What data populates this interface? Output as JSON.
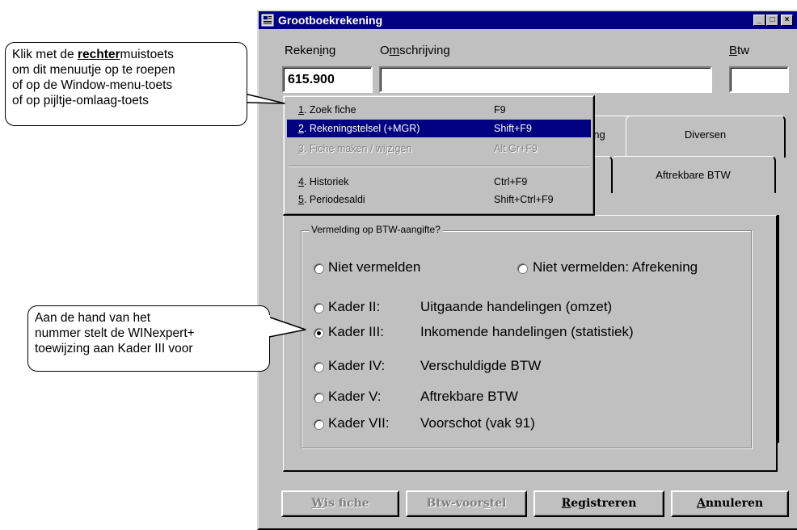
{
  "window": {
    "title": "Grootboekrekening",
    "controls": {
      "minimize": "_",
      "maximize": "□",
      "close": "×"
    }
  },
  "form": {
    "rekening_label_pre": "Reken",
    "rekening_label_key": "i",
    "rekening_label_post": "ng",
    "omschrijving_label_pre": "O",
    "omschrijving_label_key": "m",
    "omschrijving_label_post": "schrijving",
    "btw_label_key": "B",
    "btw_label_post": "tw",
    "rekening_value": "615.900",
    "omschrijving_value": "",
    "btw_value": ""
  },
  "tabs": {
    "row1": [
      "ng",
      "Diversen"
    ],
    "row2": [
      "Aftrekbare BTW"
    ]
  },
  "context_menu": {
    "items": [
      {
        "num": "1",
        "label": ". Zoek fiche",
        "shortcut": "F9",
        "state": "normal"
      },
      {
        "num": "2",
        "label": ". Rekeningstelsel (+MGR)",
        "shortcut": "Shift+F9",
        "state": "selected"
      },
      {
        "num": "3",
        "label": ". Fiche maken / wijzigen",
        "shortcut": "Alt Gr+F9",
        "state": "disabled"
      },
      {
        "num": "4",
        "label": ". Historiek",
        "shortcut": "Ctrl+F9",
        "state": "normal"
      },
      {
        "num": "5",
        "label": ". Periodesaldi",
        "shortcut": "Shift+Ctrl+F9",
        "state": "normal"
      }
    ]
  },
  "btw_group": {
    "title": "Vermelding op BTW-aangifte?",
    "top_options": [
      "Niet vermelden",
      "Niet vermelden: Afrekening"
    ],
    "kader_options": [
      {
        "kader": "Kader II:",
        "desc": "Uitgaande handelingen (omzet)",
        "checked": false
      },
      {
        "kader": "Kader III:",
        "desc": "Inkomende handelingen (statistiek)",
        "checked": true
      },
      {
        "kader": "Kader IV:",
        "desc": "Verschuldigde BTW",
        "checked": false
      },
      {
        "kader": "Kader V:",
        "desc": "Aftrekbare BTW",
        "checked": false
      },
      {
        "kader": "Kader VII:",
        "desc": "Voorschot  (vak 91)",
        "checked": false
      }
    ]
  },
  "buttons": {
    "wis_key": "W",
    "wis_rest": "is fiche",
    "btw_pre": "Btw-voor",
    "btw_key": "s",
    "btw_post": "tel",
    "reg_key": "R",
    "reg_rest": "egistreren",
    "ann_key": "A",
    "ann_rest": "nnuleren"
  },
  "callouts": {
    "top": {
      "line1_pre": "Klik met de ",
      "line1_bold": "rechter",
      "line1_post": "muistoets",
      "line2": "om dit menuutje op te roepen",
      "line3": "of op de Window-menu-toets",
      "line4": "of op pijltje-omlaag-toets"
    },
    "bottom": {
      "line1": "Aan de hand van het",
      "line2": "nummer stelt de WINexpert+",
      "line3": "toewijzing aan Kader III voor"
    }
  }
}
